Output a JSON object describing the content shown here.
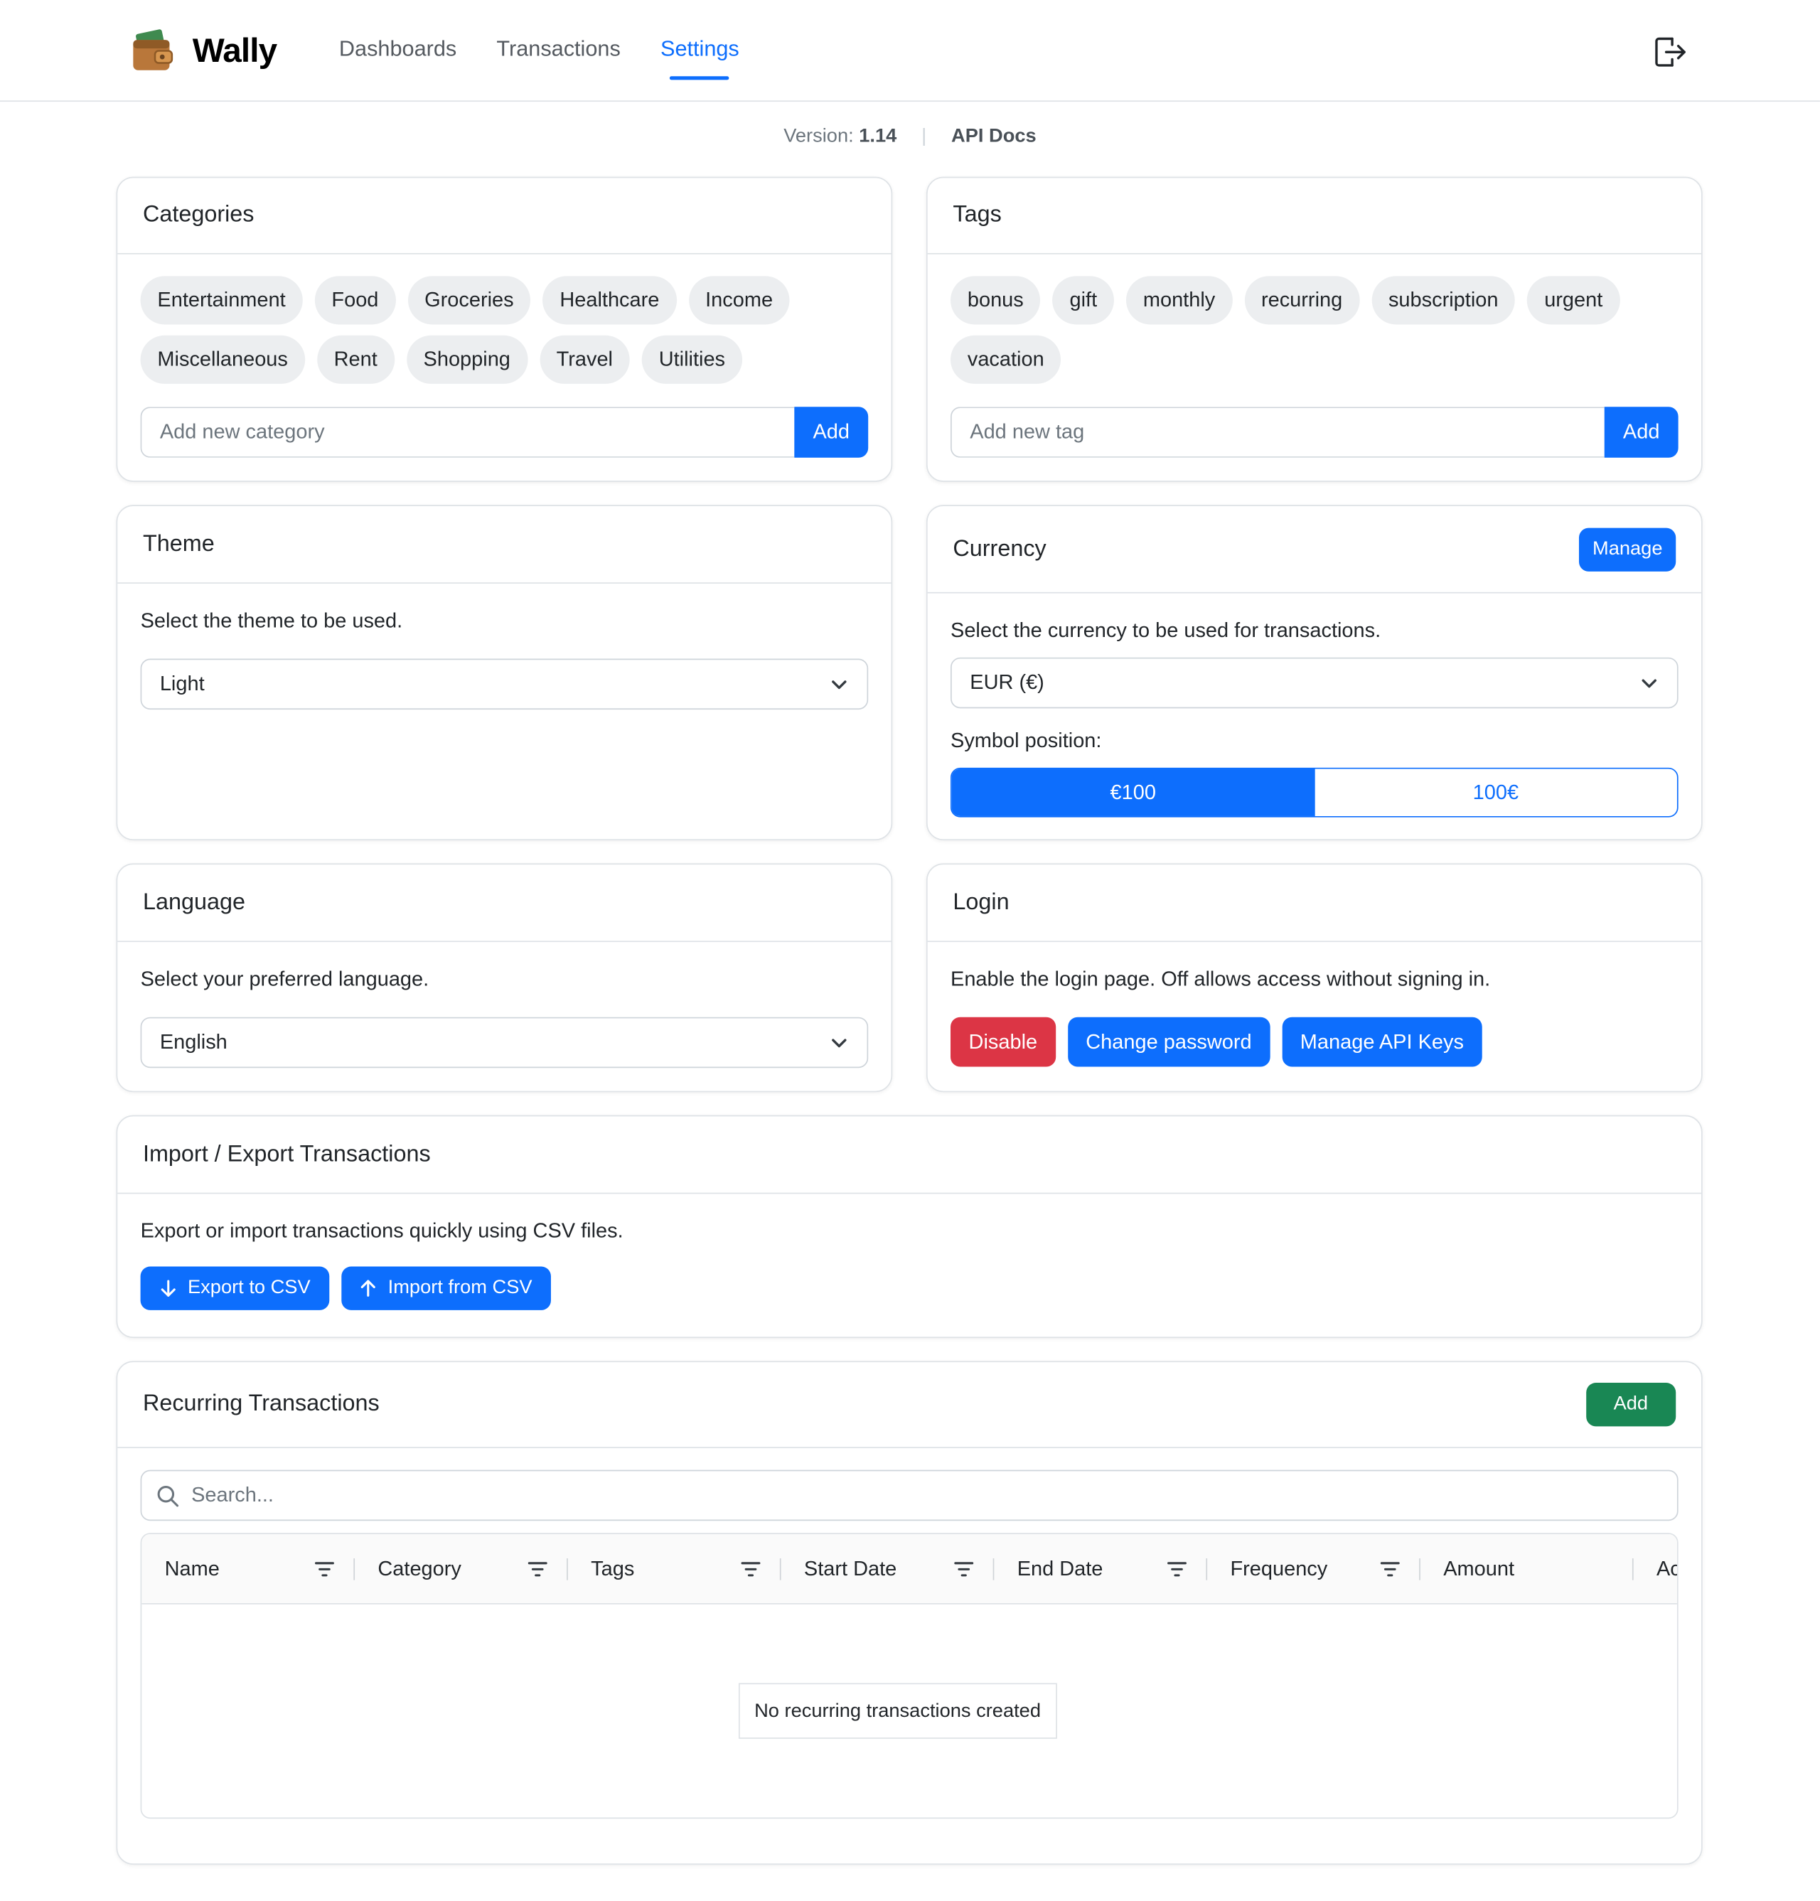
{
  "app": {
    "name": "Wally",
    "nav": [
      {
        "label": "Dashboards",
        "active": false
      },
      {
        "label": "Transactions",
        "active": false
      },
      {
        "label": "Settings",
        "active": true
      }
    ],
    "accent_color": "#0d6efd"
  },
  "version": {
    "label": "Version:",
    "value": "1.14",
    "separator": "|",
    "api_docs": "API Docs"
  },
  "categories": {
    "title": "Categories",
    "items": [
      "Entertainment",
      "Food",
      "Groceries",
      "Healthcare",
      "Income",
      "Miscellaneous",
      "Rent",
      "Shopping",
      "Travel",
      "Utilities"
    ],
    "placeholder": "Add new category",
    "add_label": "Add"
  },
  "tags": {
    "title": "Tags",
    "items": [
      "bonus",
      "gift",
      "monthly",
      "recurring",
      "subscription",
      "urgent",
      "vacation"
    ],
    "placeholder": "Add new tag",
    "add_label": "Add"
  },
  "theme": {
    "title": "Theme",
    "description": "Select the theme to be used.",
    "selected": "Light"
  },
  "currency": {
    "title": "Currency",
    "manage_label": "Manage",
    "description": "Select the currency to be used for transactions.",
    "selected": "EUR (€)",
    "symbol_label": "Symbol position:",
    "symbol_options": [
      {
        "label": "€100",
        "active": true
      },
      {
        "label": "100€",
        "active": false
      }
    ]
  },
  "language": {
    "title": "Language",
    "description": "Select your preferred language.",
    "selected": "English"
  },
  "login": {
    "title": "Login",
    "description": "Enable the login page. Off allows access without signing in.",
    "disable_label": "Disable",
    "change_password_label": "Change password",
    "api_keys_label": "Manage API Keys",
    "danger_color": "#dc3545"
  },
  "import_export": {
    "title": "Import / Export Transactions",
    "description": "Export or import transactions quickly using CSV files.",
    "export_label": "Export to CSV",
    "import_label": "Import from CSV"
  },
  "recurring": {
    "title": "Recurring Transactions",
    "add_label": "Add",
    "add_color": "#198754",
    "search_placeholder": "Search...",
    "columns": [
      "Name",
      "Category",
      "Tags",
      "Start Date",
      "End Date",
      "Frequency",
      "Amount",
      "Ac"
    ],
    "empty_message": "No recurring transactions created"
  }
}
